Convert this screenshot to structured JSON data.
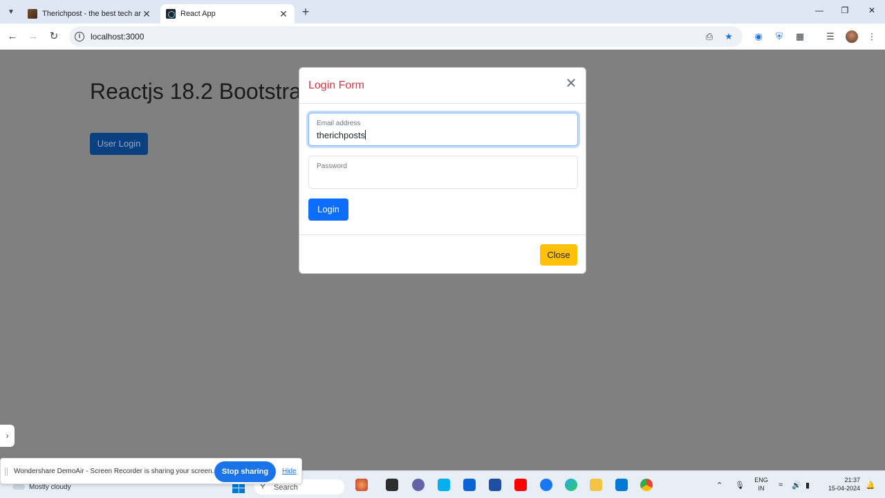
{
  "browser": {
    "tabs": [
      {
        "title": "Therichpost - the best tech and",
        "active": false
      },
      {
        "title": "React App",
        "active": true
      }
    ],
    "url": "localhost:3000",
    "icons": {
      "tab_search": "chevron-down-icon",
      "new_tab": "plus-icon",
      "back": "arrow-left-icon",
      "forward": "arrow-right-icon",
      "reload": "reload-icon",
      "site_info": "info-icon",
      "install": "install-icon",
      "bookmark": "star-icon",
      "extensions": "puzzle-icon",
      "media": "media-control-icon",
      "menu": "kebab-menu-icon"
    }
  },
  "page": {
    "heading": "Reactjs 18.2 Bootstra",
    "user_login_button": "User Login"
  },
  "modal": {
    "title": "Login Form",
    "email_label": "Email address",
    "email_value": "therichposts",
    "password_label": "Password",
    "password_value": "",
    "login_button": "Login",
    "close_button": "Close",
    "title_color": "#dc3545",
    "primary_color": "#0d6efd",
    "warning_color": "#ffc107"
  },
  "share_bar": {
    "message": "Wondershare DemoAir - Screen Recorder is sharing your screen.",
    "stop_button": "Stop sharing",
    "hide_link": "Hide"
  },
  "taskbar": {
    "weather": "Mostly cloudy",
    "search_placeholder": "Search",
    "language_line1": "ENG",
    "language_line2": "IN",
    "time": "21:37",
    "date": "15-04-2024"
  }
}
